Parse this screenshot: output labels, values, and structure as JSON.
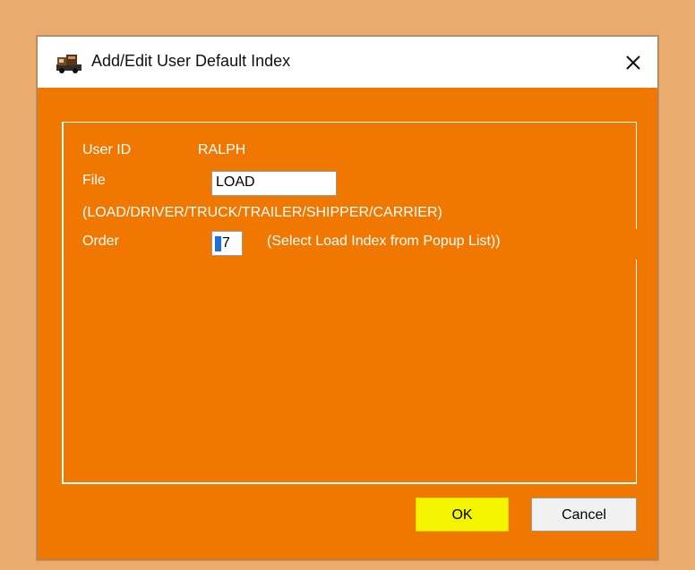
{
  "window": {
    "title": "Add/Edit User Default Index",
    "icon": "truck-icon",
    "close_icon": "close-icon"
  },
  "form": {
    "user_id_label": "User ID",
    "user_id_value": "RALPH",
    "file_label": "File",
    "file_value": "LOAD",
    "file_hint": "(LOAD/DRIVER/TRUCK/TRAILER/SHIPPER/CARRIER)",
    "order_label": "Order",
    "order_value": "7",
    "order_hint": "(Select Load Index from Popup List))"
  },
  "buttons": {
    "ok_label": "OK",
    "cancel_label": "Cancel"
  },
  "colors": {
    "dialog_bg": "#f07700",
    "outside_bg": "#e9ab6e",
    "ok_highlight": "#f5f400",
    "text": "#ffffff"
  }
}
